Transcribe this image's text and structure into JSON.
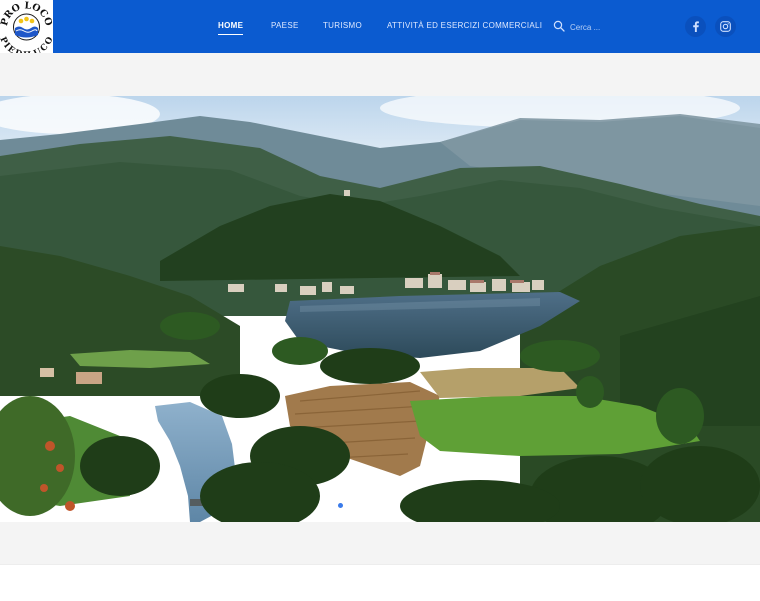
{
  "header": {
    "logo": {
      "text_top": "PRO LOCO",
      "text_bottom": "PIEDILUCO",
      "icon": "pro-loco-emblem"
    },
    "nav": [
      {
        "label": "HOME",
        "active": true
      },
      {
        "label": "PAESE",
        "active": false
      },
      {
        "label": "TURISMO",
        "active": false
      },
      {
        "label": "ATTIVITÀ ED ESERCIZI COMMERCIALI",
        "active": false
      }
    ],
    "search": {
      "placeholder": "Cerca ...",
      "icon": "search-icon"
    },
    "social": [
      {
        "name": "facebook",
        "icon": "facebook-icon"
      },
      {
        "name": "instagram",
        "icon": "instagram-icon"
      }
    ]
  },
  "hero": {
    "image": "lake-piediluco-landscape",
    "slides_total": 1,
    "active_slide": 1
  },
  "colors": {
    "header_bg": "#0b5bd0",
    "band_bg": "#f4f4f4",
    "accent": "#3a7bea"
  }
}
